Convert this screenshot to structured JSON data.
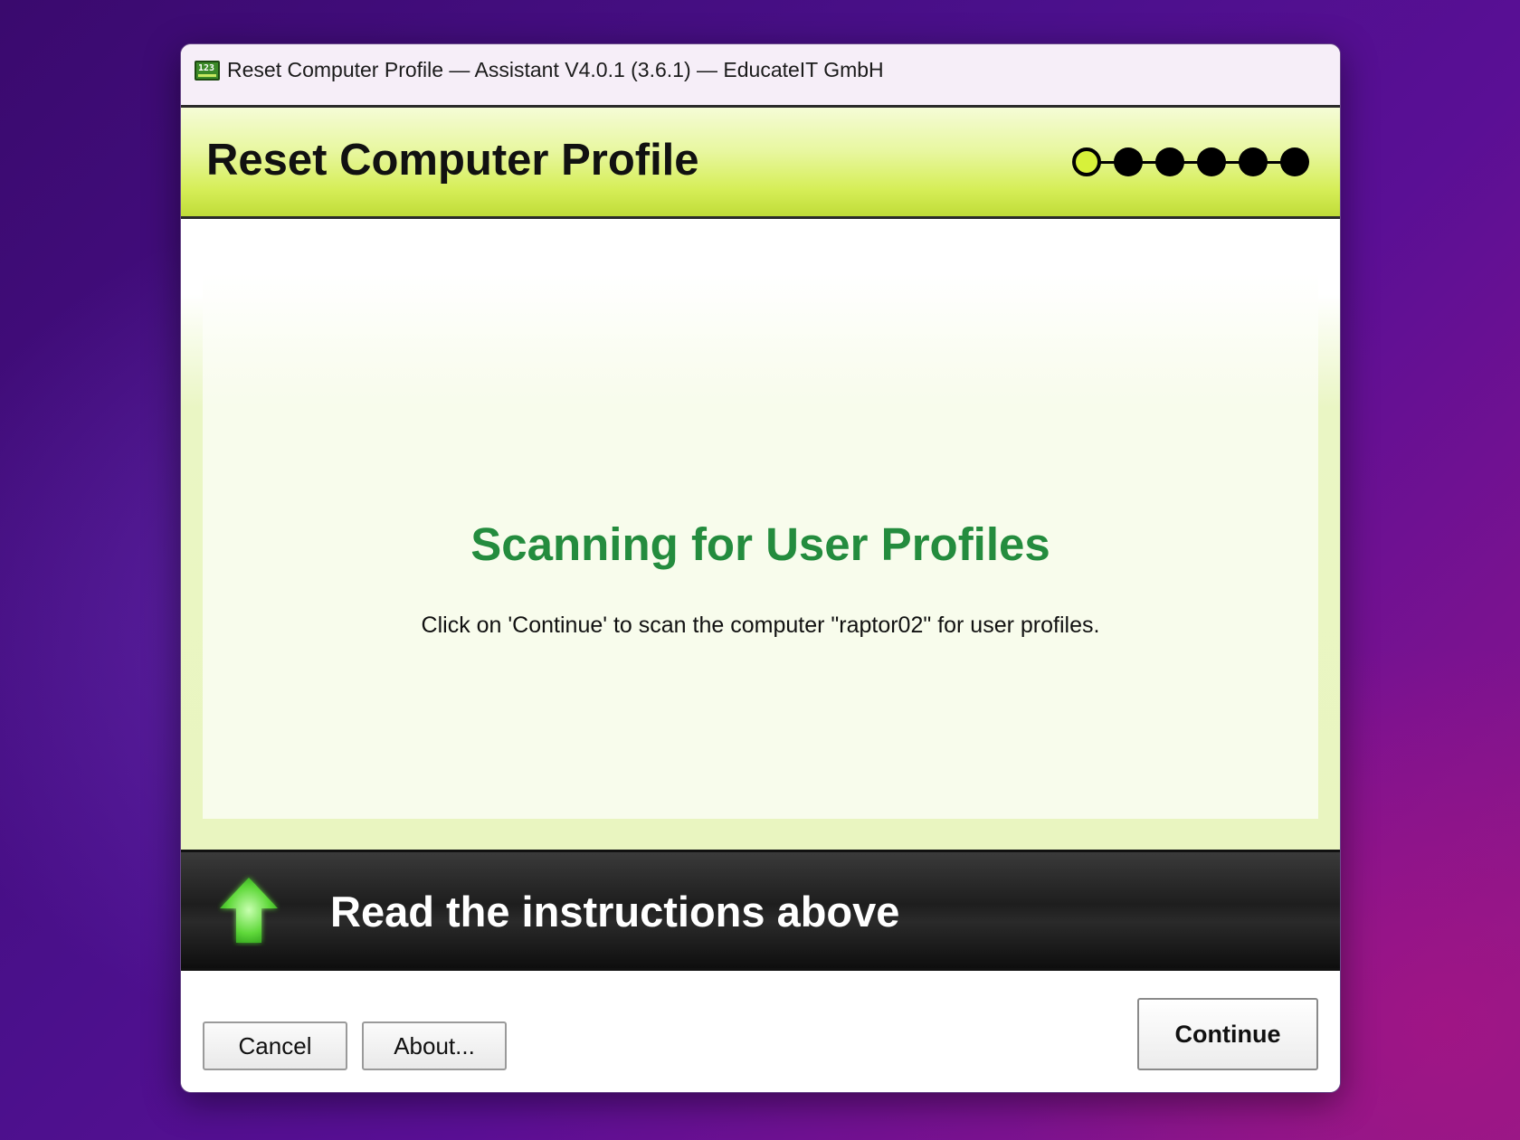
{
  "window": {
    "title": "Reset Computer Profile — Assistant V4.0.1 (3.6.1) — EducateIT GmbH",
    "app_icon_text": "123",
    "help_label": "?",
    "icons": {
      "app": "app-icon",
      "close": "close-icon"
    }
  },
  "header": {
    "title": "Reset Computer Profile",
    "steps": {
      "total": 6,
      "current": 1
    },
    "accent_color": "#d7f13a"
  },
  "main": {
    "heading": "Scanning for User Profiles",
    "description": "Click on 'Continue' to scan the computer \"raptor02\" for user profiles.",
    "heading_color": "#248c3e"
  },
  "instructions": {
    "text": "Read the instructions above",
    "icon": "up-arrow-icon"
  },
  "footer": {
    "cancel_label": "Cancel",
    "about_label": "About...",
    "continue_label": "Continue"
  }
}
